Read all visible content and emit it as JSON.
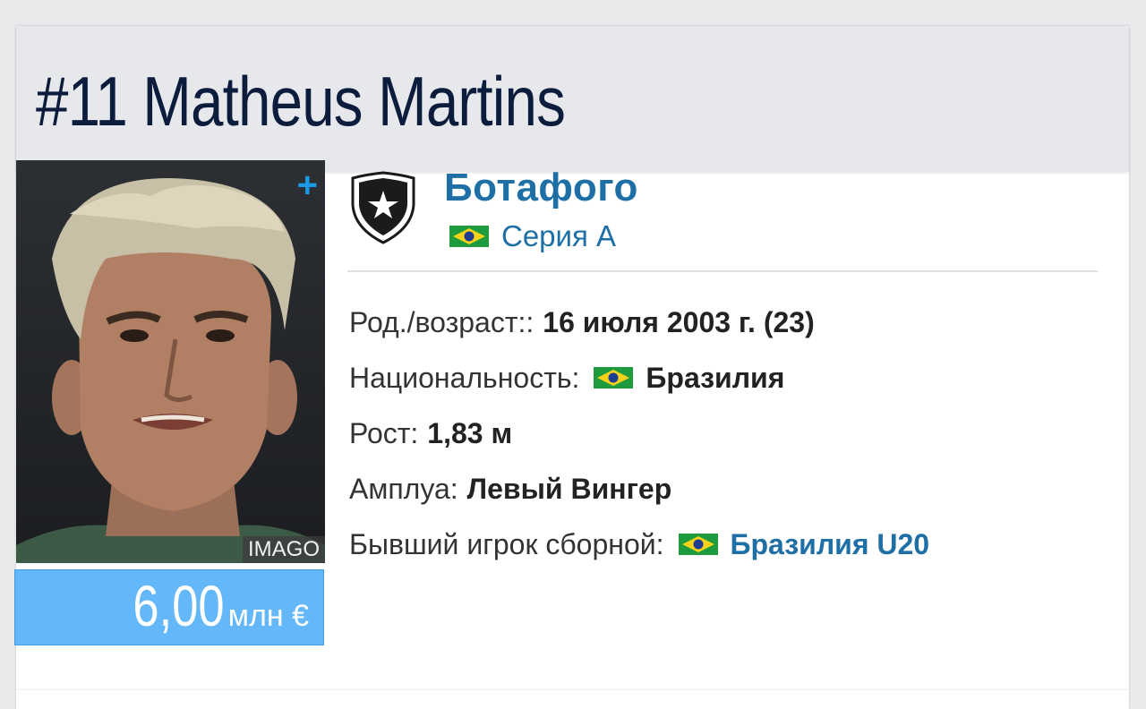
{
  "player": {
    "title": "#11 Matheus Martins",
    "photo_credit": "IMAGO",
    "plus_icon": "plus-icon",
    "market_value_amount": "6,00",
    "market_value_unit": "млн €"
  },
  "club": {
    "name": "Ботафого",
    "crest_icon": "botafogo-crest-icon",
    "league": "Серия А",
    "league_flag": "brazil-flag-icon"
  },
  "info": {
    "birth_label": "Род./возраст::",
    "birth_value": "16 июля 2003 г. (23)",
    "nationality_label": "Национальность:",
    "nationality_value": "Бразилия",
    "height_label": "Рост:",
    "height_value": "1,83 м",
    "position_label": "Амплуа:",
    "position_value": "Левый Вингер",
    "former_label": "Бывший игрок сборной:",
    "former_value": "Бразилия U20"
  },
  "colors": {
    "link": "#1e6fa5",
    "market_value_bg": "#64b7f8",
    "title": "#0c1c3c",
    "header_bg": "#e6e8eb"
  }
}
